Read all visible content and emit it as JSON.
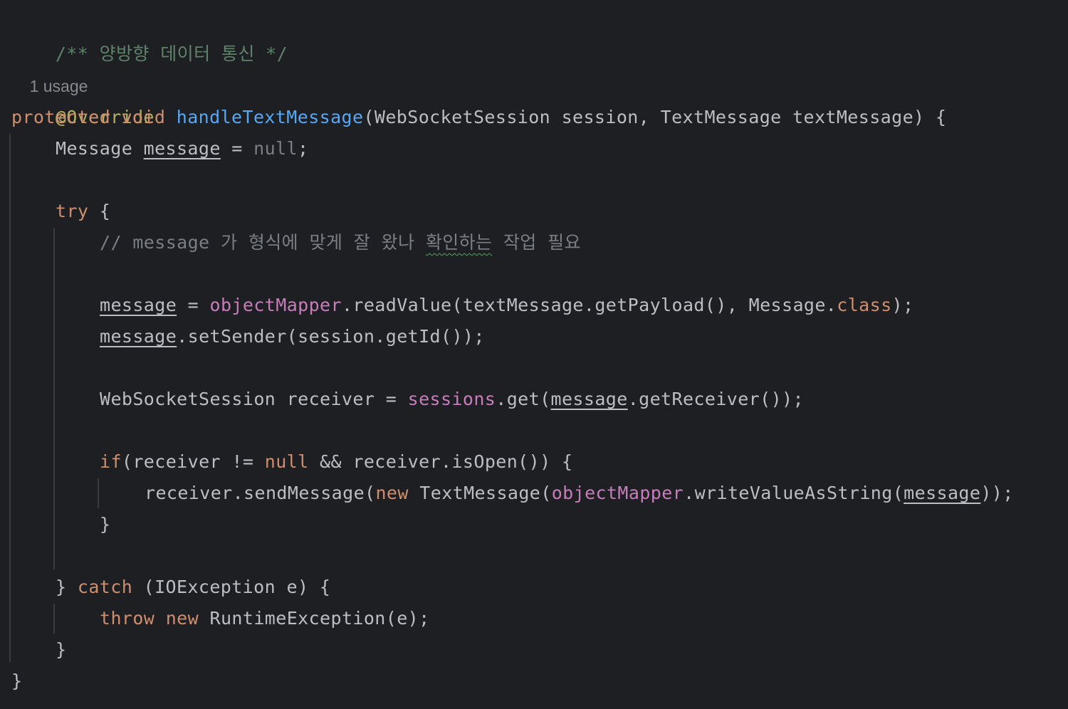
{
  "editor": {
    "theme_colors": {
      "background": "#1e1f22",
      "text": "#bcbec4",
      "keyword": "#cf8e6d",
      "method_declaration": "#56a8f5",
      "field": "#c77dbb",
      "annotation": "#b3ae60",
      "comment": "#7a7e85",
      "doc_comment": "#5f826b"
    },
    "doc_comment": "/** 양방향 데이터 통신 */",
    "usage_hint": "1 usage",
    "annotation": "@Override",
    "signature": {
      "modifier": "protected",
      "return_type": "void",
      "method_name": "handleTextMessage",
      "params": "(WebSocketSession session, TextMessage textMessage) {"
    },
    "line_message_decl": {
      "type": "Message ",
      "var": "message",
      "assign": " = ",
      "null_kw": "null",
      "end": ";"
    },
    "try_kw": "try",
    "try_brace": " {",
    "comment": {
      "prefix": "// message 가 형식에 맞게 잘 왔나 ",
      "flagged_word": "확인하는",
      "suffix": " 작업 필요"
    },
    "line_read_value": {
      "var": "message",
      "assign": " = ",
      "field": "objectMapper",
      "call": ".readValue(textMessage.getPayload(), Message.",
      "class_kw": "class",
      "end": ");"
    },
    "line_set_sender": {
      "var": "message",
      "call": ".setSender(session.getId());"
    },
    "line_receiver": {
      "decl": "WebSocketSession receiver = ",
      "field": "sessions",
      "call": ".get(",
      "var": "message",
      "end": ".getReceiver());"
    },
    "line_if": {
      "kw": "if",
      "cond_a": "(receiver != ",
      "null_kw": "null",
      "cond_b": " && receiver.isOpen()) {"
    },
    "line_send": {
      "call": "receiver.sendMessage(",
      "new_kw": "new",
      "ctor": " TextMessage(",
      "field": "objectMapper",
      "write": ".writeValueAsString(",
      "var": "message",
      "end": "));"
    },
    "close_if": "}",
    "catch_line": {
      "open": "} ",
      "kw": "catch",
      "rest": " (IOException e) {"
    },
    "throw_line": {
      "throw_kw": "throw",
      "new_kw": "new",
      "rest": " RuntimeException(e);"
    },
    "close_catch": "}",
    "close_method": "}"
  }
}
